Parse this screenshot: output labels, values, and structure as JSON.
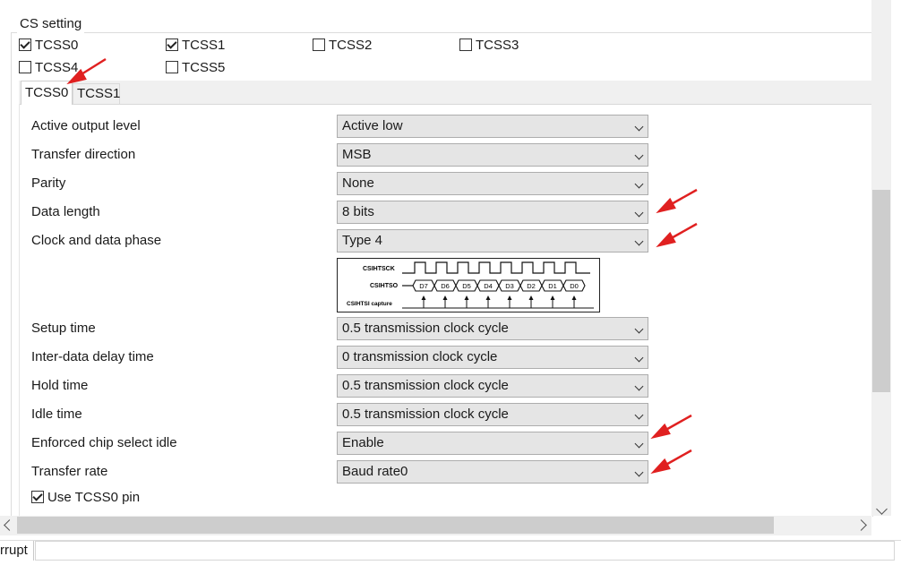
{
  "group": {
    "title": "CS setting"
  },
  "checkboxes": [
    {
      "label": "TCSS0",
      "checked": true
    },
    {
      "label": "TCSS1",
      "checked": true
    },
    {
      "label": "TCSS2",
      "checked": false
    },
    {
      "label": "TCSS3",
      "checked": false
    },
    {
      "label": "TCSS4",
      "checked": false
    },
    {
      "label": "TCSS5",
      "checked": false
    }
  ],
  "tabs": [
    {
      "label": "TCSS0",
      "active": true
    },
    {
      "label": "TCSS1",
      "active": false
    }
  ],
  "settings": [
    {
      "label": "Active output level",
      "value": "Active low"
    },
    {
      "label": "Transfer direction",
      "value": "MSB"
    },
    {
      "label": "Parity",
      "value": "None"
    },
    {
      "label": "Data length",
      "value": "8 bits"
    },
    {
      "label": "Clock and data phase",
      "value": "Type 4"
    },
    {
      "label": "Setup time",
      "value": "0.5 transmission clock cycle"
    },
    {
      "label": "Inter-data delay time",
      "value": "0 transmission clock cycle"
    },
    {
      "label": "Hold time",
      "value": "0.5 transmission clock cycle"
    },
    {
      "label": "Idle time",
      "value": "0.5 transmission clock cycle"
    },
    {
      "label": "Enforced chip select idle",
      "value": "Enable"
    },
    {
      "label": "Transfer rate",
      "value": "Baud rate0"
    }
  ],
  "timing_diagram": {
    "signals": [
      "CSIHTSCK",
      "CSIHTSO",
      "CSIHTSI capture"
    ],
    "bits": [
      "D7",
      "D6",
      "D5",
      "D4",
      "D3",
      "D2",
      "D1",
      "D0"
    ]
  },
  "use_pin": {
    "label": "Use TCSS0 pin",
    "checked": true
  },
  "status": {
    "text": "rrupt"
  },
  "colors": {
    "annotation_arrow": "#e02020",
    "combo_bg": "#e5e5e5",
    "scroll_thumb": "#cdcdcd"
  }
}
